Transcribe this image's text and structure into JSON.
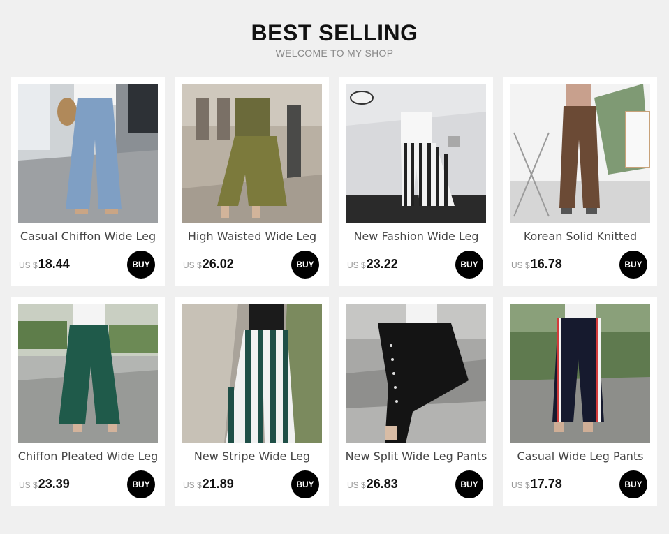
{
  "header": {
    "title": "BEST SELLING",
    "subtitle": "WELCOME TO MY SHOP"
  },
  "products": [
    {
      "name": "Casual Chiffon Wide Leg",
      "currency": "US $",
      "price": "18.44",
      "buy_label": "BUY",
      "image": "blue-chiffon-pants-photo"
    },
    {
      "name": "High Waisted Wide Leg",
      "currency": "US $",
      "price": "26.02",
      "buy_label": "BUY",
      "image": "olive-wide-leg-pants-photo"
    },
    {
      "name": "New Fashion Wide Leg",
      "currency": "US $",
      "price": "23.22",
      "buy_label": "BUY",
      "image": "striped-wide-leg-pants-photo"
    },
    {
      "name": "Korean Solid Knitted",
      "currency": "US $",
      "price": "16.78",
      "buy_label": "BUY",
      "image": "brown-knitted-pants-photo"
    },
    {
      "name": "Chiffon Pleated Wide Leg",
      "currency": "US $",
      "price": "23.39",
      "buy_label": "BUY",
      "image": "green-pleated-pants-photo"
    },
    {
      "name": "New Stripe Wide Leg",
      "currency": "US $",
      "price": "21.89",
      "buy_label": "BUY",
      "image": "green-white-stripe-pants-photo"
    },
    {
      "name": "New Split Wide Leg Pants",
      "currency": "US $",
      "price": "26.83",
      "buy_label": "BUY",
      "image": "black-split-pants-photo"
    },
    {
      "name": "Casual Wide Leg Pants",
      "currency": "US $",
      "price": "17.78",
      "buy_label": "BUY",
      "image": "navy-side-stripe-pants-photo"
    }
  ]
}
